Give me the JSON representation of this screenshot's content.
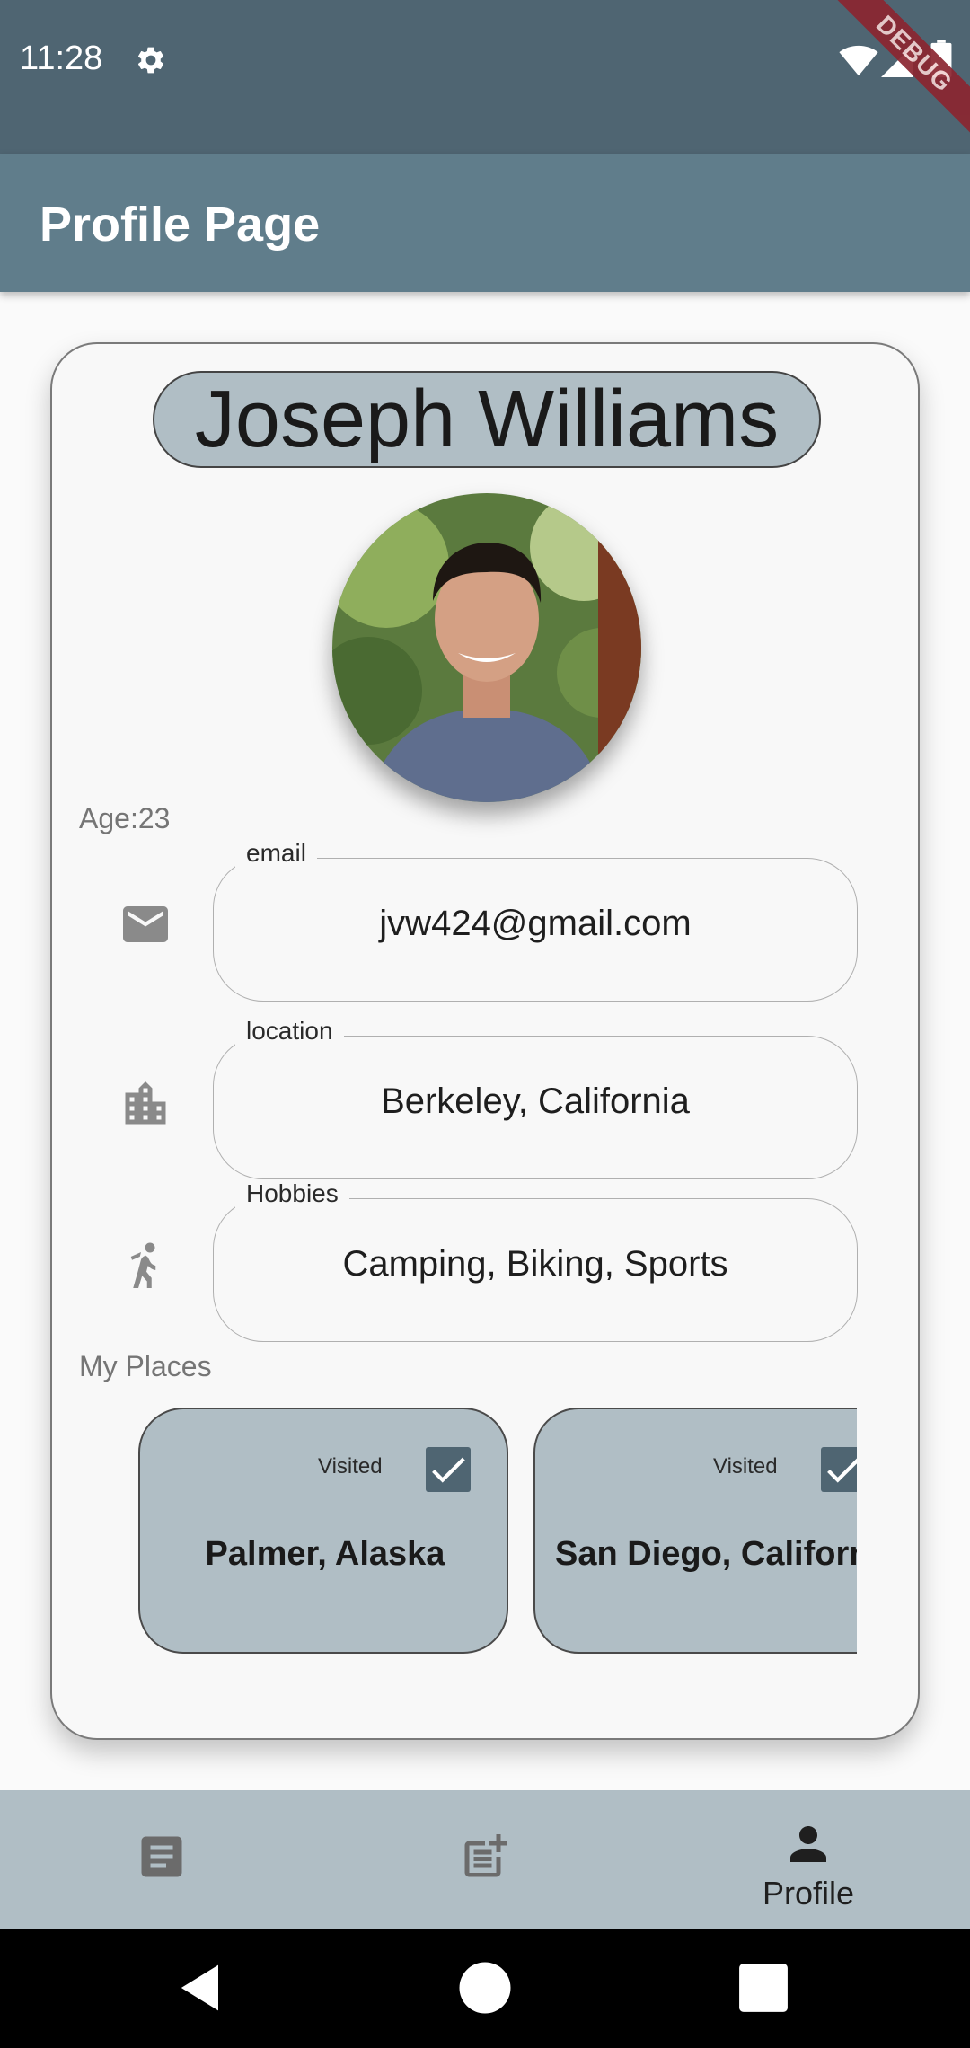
{
  "status_bar": {
    "time": "11:28",
    "debug_banner": "DEBUG"
  },
  "app_bar": {
    "title": "Profile Page"
  },
  "profile": {
    "name": "Joseph Williams",
    "age": "Age:23",
    "fields": [
      {
        "label": "email",
        "value": "jvw424@gmail.com",
        "icon": "email-icon"
      },
      {
        "label": "location",
        "value": "Berkeley, California",
        "icon": "building-icon"
      },
      {
        "label": "Hobbies",
        "value": "Camping, Biking, Sports",
        "icon": "sports-icon"
      }
    ],
    "places_label": "My Places",
    "places": [
      {
        "name": "Palmer, Alaska",
        "visited_label": "Visited",
        "visited": true
      },
      {
        "name": "San Diego, California",
        "visited_label": "Visited",
        "visited": true
      }
    ]
  },
  "bottom_nav": {
    "items": [
      {
        "icon": "article-icon",
        "label": ""
      },
      {
        "icon": "post-add-icon",
        "label": ""
      },
      {
        "icon": "person-icon",
        "label": "Profile"
      }
    ]
  },
  "colors": {
    "status_bar": "#4f6572",
    "app_bar": "#607d8b",
    "accent_pill": "#b0bec5",
    "checkbox": "#4f6572"
  }
}
